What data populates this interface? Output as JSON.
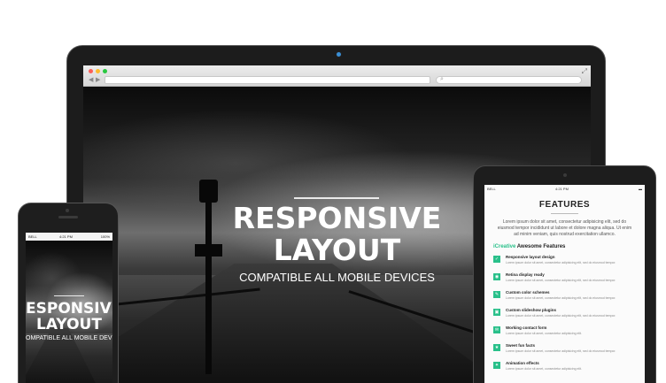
{
  "desktop": {
    "hero_title_line1": "RESPONSIVE",
    "hero_title_line2": "LAYOUT",
    "hero_subtitle": "COMPATIBLE ALL MOBILE DEVICES"
  },
  "phone": {
    "carrier": "BELL",
    "time": "4:21 PM",
    "battery": "100%",
    "hero_title_line1": "ESPONSIVE",
    "hero_title_line2": "LAYOUT",
    "hero_subtitle": "OMPATIBLE ALL MOBILE DEVICE"
  },
  "tablet": {
    "carrier": "BELL",
    "time": "4:21 PM",
    "title": "FEATURES",
    "description": "Lorem ipsum dolor sit amet, consectetur adipisicing elit, sed do eiusmod tempor incididunt ut labore et dolore magna aliqua. Ut enim ad minim veniam, quis nostrud exercitation ullamco.",
    "subheading_brand": "iCreative",
    "subheading_rest": " Awesome Features",
    "features": [
      {
        "title": "Responsive layout design",
        "desc": "Lorem ipsum dolor sit amet, consectetur adipisicing elit, sed do eiusmod tempor."
      },
      {
        "title": "Retina display ready",
        "desc": "Lorem ipsum dolor sit amet, consectetur adipisicing elit, sed do eiusmod tempor."
      },
      {
        "title": "Custom color schemes",
        "desc": "Lorem ipsum dolor sit amet, consectetur adipisicing elit, sed do eiusmod tempor."
      },
      {
        "title": "Custom slideshow plugins",
        "desc": "Lorem ipsum dolor sit amet, consectetur adipisicing elit, sed do eiusmod tempor."
      },
      {
        "title": "Working contact form",
        "desc": "Lorem ipsum dolor sit amet, consectetur adipisicing elit."
      },
      {
        "title": "Sweet fun facts",
        "desc": "Lorem ipsum dolor sit amet, consectetur adipisicing elit, sed do eiusmod tempor."
      },
      {
        "title": "Animation effects",
        "desc": "Lorem ipsum dolor sit amet, consectetur adipisicing elit."
      }
    ]
  },
  "colors": {
    "accent": "#29c08a",
    "close_dot": "#fc5f57",
    "minimize_dot": "#fdbc2e",
    "maximize_dot": "#28c840"
  }
}
